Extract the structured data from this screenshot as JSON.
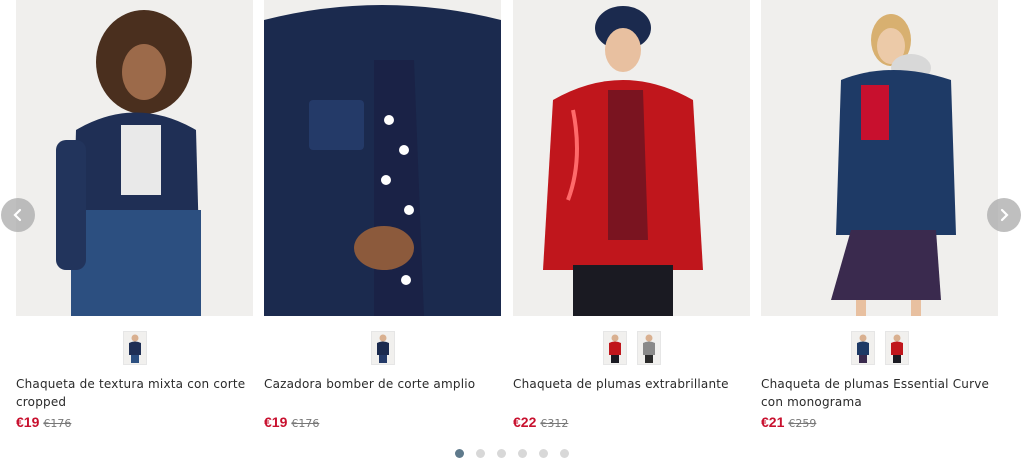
{
  "carousel": {
    "prev_icon": "chevron-left-icon",
    "next_icon": "chevron-right-icon",
    "page_count": 6,
    "active_page": 1,
    "currency_color": "#c8102e"
  },
  "products": [
    {
      "name": "Chaqueta de textura mixta con corte cropped",
      "price": "€19",
      "original_price": "€176",
      "thumbnails": [
        "navy-jacket"
      ]
    },
    {
      "name": "Cazadora bomber de corte amplio",
      "price": "€19",
      "original_price": "€176",
      "thumbnails": [
        "navy-bomber"
      ]
    },
    {
      "name": "Chaqueta de plumas extrabrillante",
      "price": "€22",
      "original_price": "€312",
      "thumbnails": [
        "red-puffer",
        "grey-puffer"
      ]
    },
    {
      "name": "Chaqueta de plumas Essential Curve con monograma",
      "price": "€21",
      "original_price": "€259",
      "thumbnails": [
        "navy-puffer",
        "red-puffer"
      ]
    }
  ]
}
